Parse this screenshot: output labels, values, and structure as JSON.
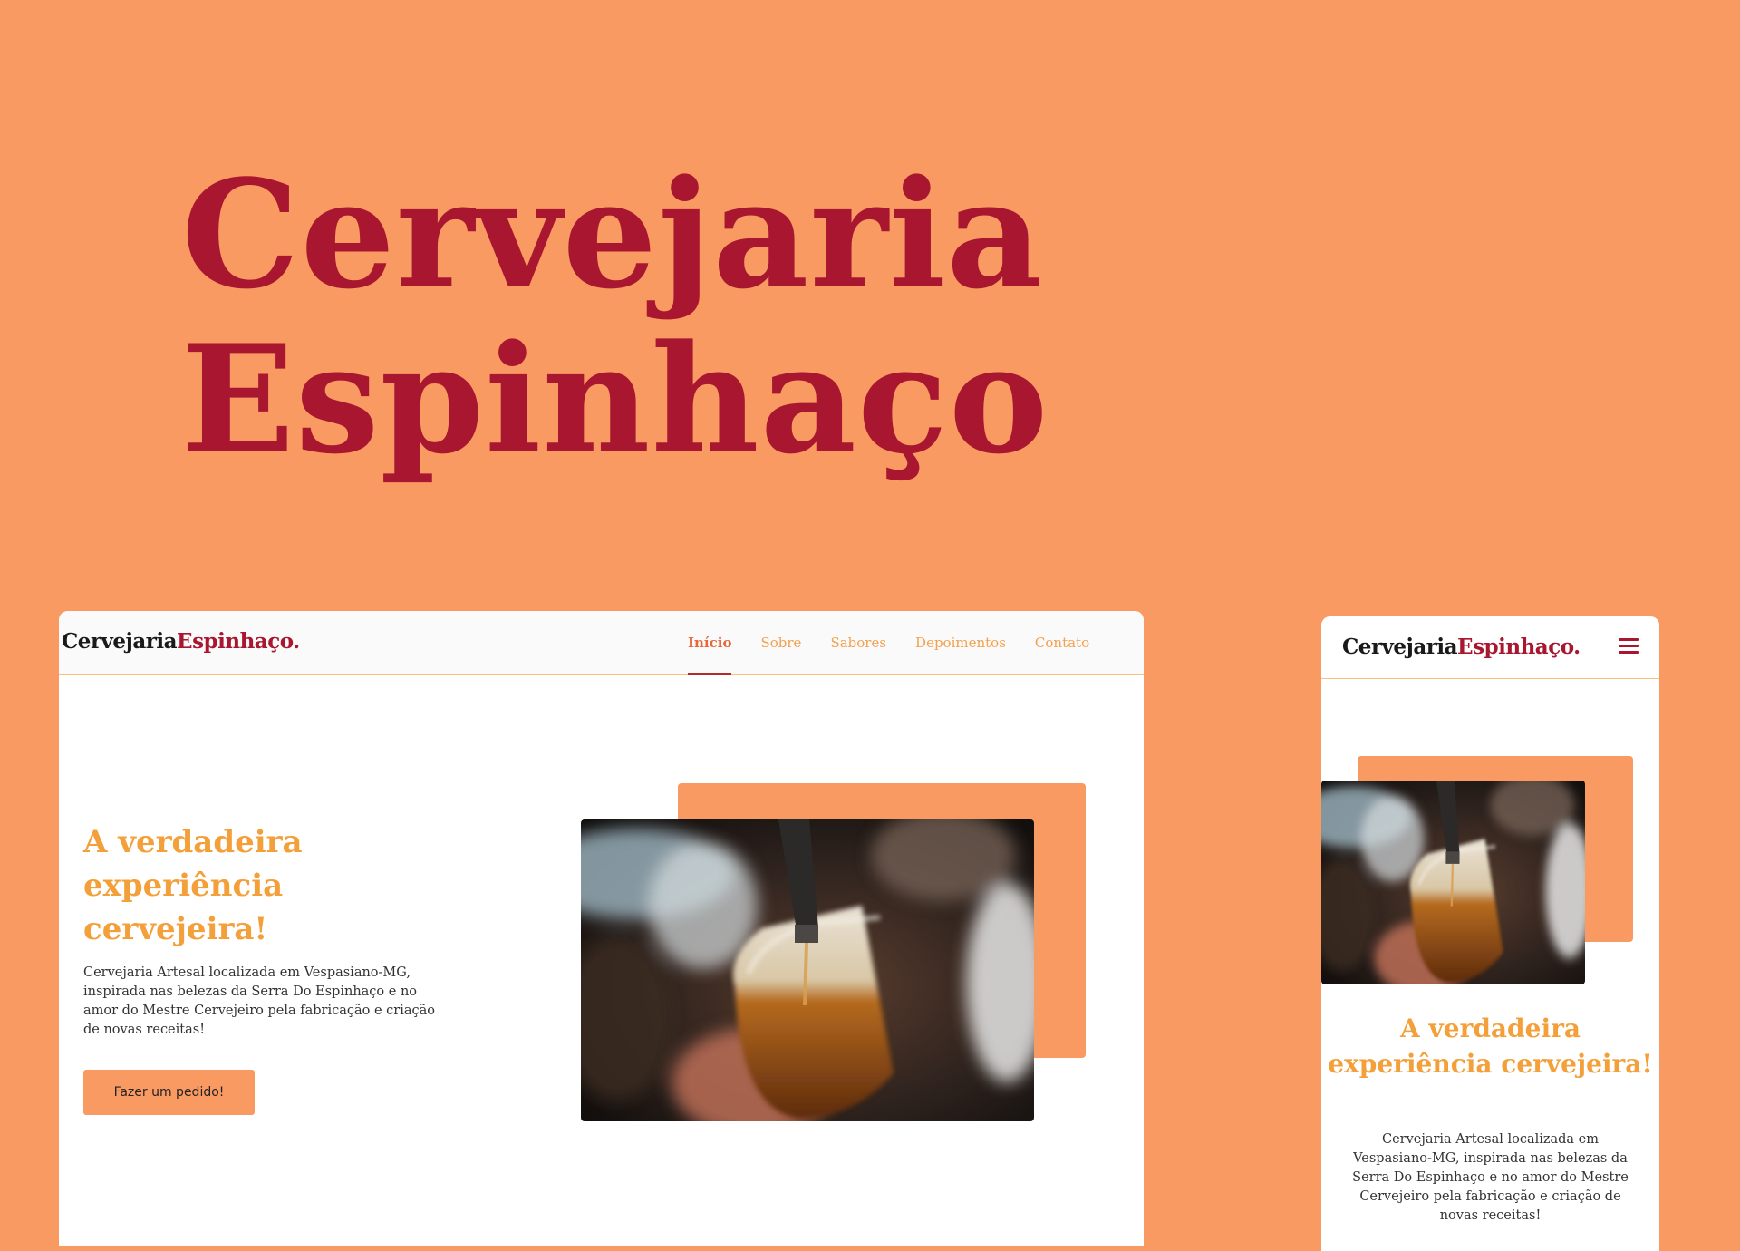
{
  "hero": {
    "line1": "Cervejaria",
    "line2": "Espinhaço"
  },
  "brand": {
    "part1": "Cervejaria",
    "part2": "Espinhaço."
  },
  "desktop": {
    "nav": [
      "Início",
      "Sobre",
      "Sabores",
      "Depoimentos",
      "Contato"
    ],
    "active_nav": "Início",
    "headline": "A verdadeira experiência cervejeira!",
    "description": "Cervejaria Artesal localizada em Vespasiano-MG, inspirada nas belezas da Serra Do Espinhaço e no amor do Mestre Cervejeiro pela fabricação e criação de novas receitas!",
    "cta_label": "Fazer um pedido!"
  },
  "mobile": {
    "menu_icon": "hamburger-menu-icon",
    "headline": "A verdadeira experiência cervejeira!",
    "description": "Cervejaria Artesal localizada em Vespasiano-MG, inspirada nas belezas da Serra Do Espinhaço e no amor do Mestre Cervejeiro pela fabricação e criação de novas receitas!"
  },
  "colors": {
    "background": "#FA9A63",
    "brand_red": "#A8172F",
    "headline_orange": "#F4A03A",
    "nav_orange": "#F4A04E"
  }
}
